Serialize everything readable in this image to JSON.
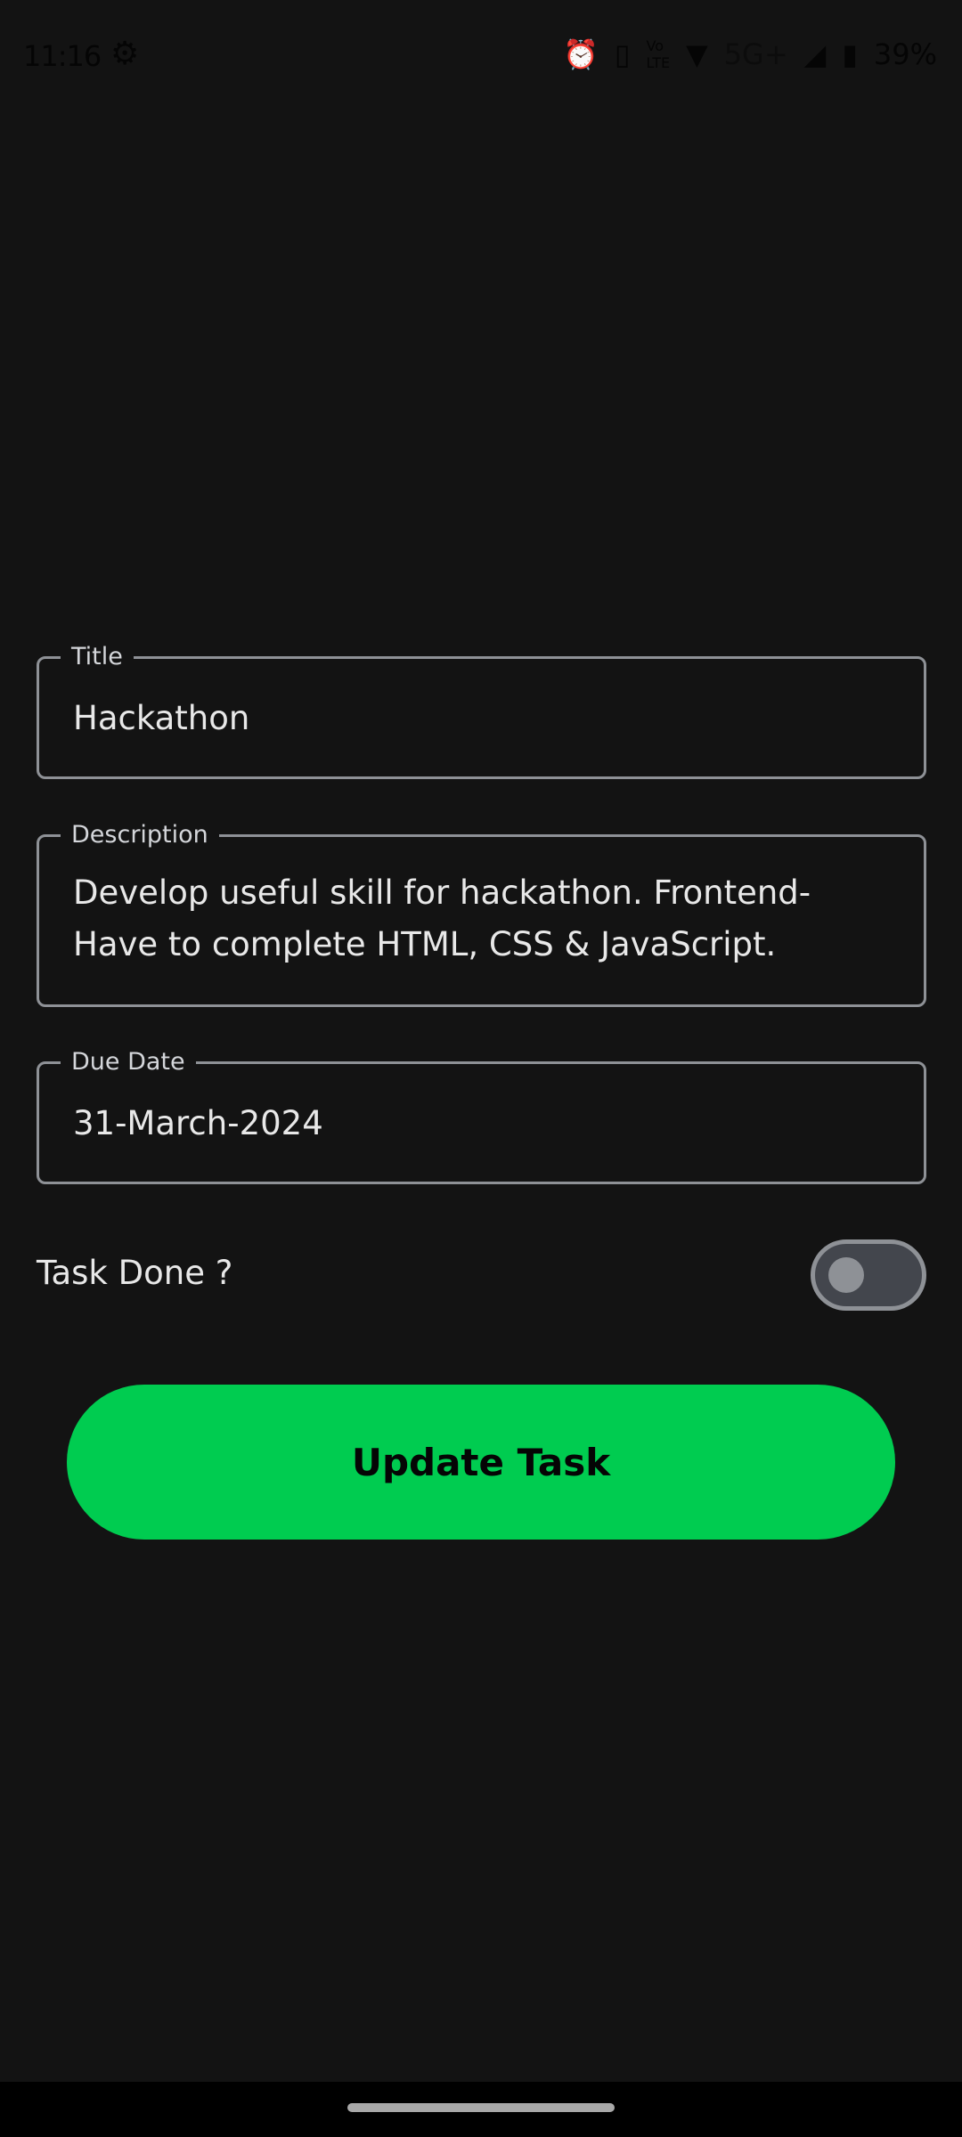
{
  "status_bar": {
    "time": "11:16",
    "battery": "39%",
    "network": "5G+",
    "icons": [
      "debug-icon",
      "alarm-icon",
      "vibrate-icon",
      "volte-icon",
      "wifi-icon",
      "signal-icon",
      "battery-charging-icon"
    ]
  },
  "form": {
    "title": {
      "label": "Title",
      "value": "Hackathon"
    },
    "description": {
      "label": "Description",
      "lines": [
        "Develop useful skill for hackathon. Frontend-",
        "Have to complete HTML, CSS & JavaScript."
      ]
    },
    "due_date": {
      "label": "Due Date",
      "value": "31-March-2024"
    },
    "task_done": {
      "label": "Task Done ?",
      "checked": false
    },
    "submit_label": "Update Task"
  },
  "colors": {
    "background": "#131313",
    "accent": "#00cc50",
    "border": "#8e9196"
  }
}
